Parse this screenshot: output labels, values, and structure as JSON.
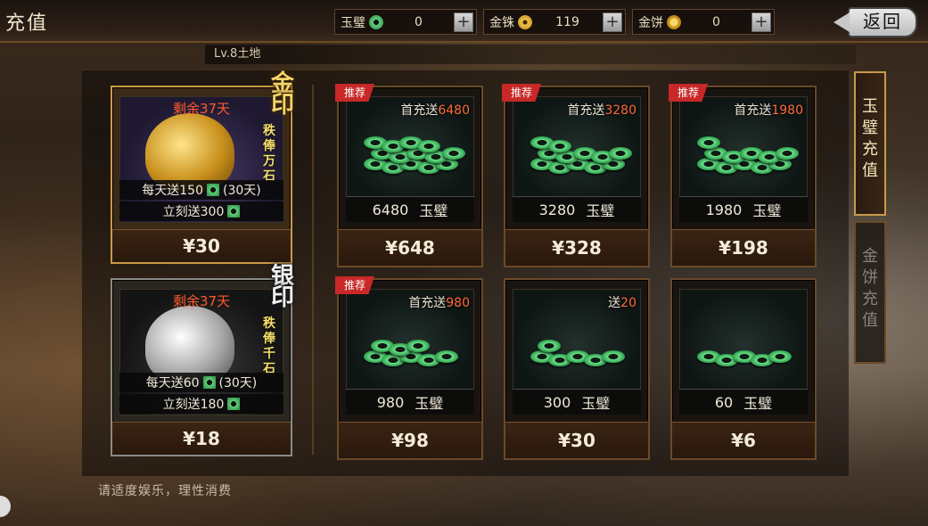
{
  "header": {
    "title": "充值",
    "back_label": "返回",
    "currencies": [
      {
        "label": "玉璧",
        "icon": "jade-coin-icon",
        "value": "0"
      },
      {
        "label": "金铢",
        "icon": "gold-coin-icon",
        "value": "119"
      },
      {
        "label": "金饼",
        "icon": "gold-cake-icon",
        "value": "0"
      }
    ],
    "plus_label": "+"
  },
  "level_text": "Lv.8土地",
  "seals": [
    {
      "name": "金印",
      "motto": "秩俸万石",
      "days_left": "剩余37天",
      "daily": "每天送150",
      "daily_suffix": "(30天)",
      "instant": "立刻送300",
      "price": "¥30"
    },
    {
      "name": "银印",
      "motto": "秩俸千石",
      "days_left": "剩余37天",
      "daily": "每天送60",
      "daily_suffix": "(30天)",
      "instant": "立刻送180",
      "price": "¥18"
    }
  ],
  "packs": [
    {
      "tag": "推荐",
      "bonus_prefix": "首充送",
      "bonus_num": "6480",
      "amount": "6480",
      "unit": "玉璧",
      "price": "¥648"
    },
    {
      "tag": "推荐",
      "bonus_prefix": "首充送",
      "bonus_num": "3280",
      "amount": "3280",
      "unit": "玉璧",
      "price": "¥328"
    },
    {
      "tag": "推荐",
      "bonus_prefix": "首充送",
      "bonus_num": "1980",
      "amount": "1980",
      "unit": "玉璧",
      "price": "¥198"
    },
    {
      "tag": "推荐",
      "bonus_prefix": "首充送",
      "bonus_num": "980",
      "amount": "980",
      "unit": "玉璧",
      "price": "¥98"
    },
    {
      "tag": "",
      "bonus_prefix": "送",
      "bonus_num": "20",
      "amount": "300",
      "unit": "玉璧",
      "price": "¥30"
    },
    {
      "tag": "",
      "bonus_prefix": "",
      "bonus_num": "",
      "amount": "60",
      "unit": "玉璧",
      "price": "¥6"
    }
  ],
  "tabs": [
    {
      "label": "玉璧充值",
      "active": true
    },
    {
      "label": "金饼充值",
      "active": false
    }
  ],
  "footer_text": "请适度娱乐，理性消费"
}
